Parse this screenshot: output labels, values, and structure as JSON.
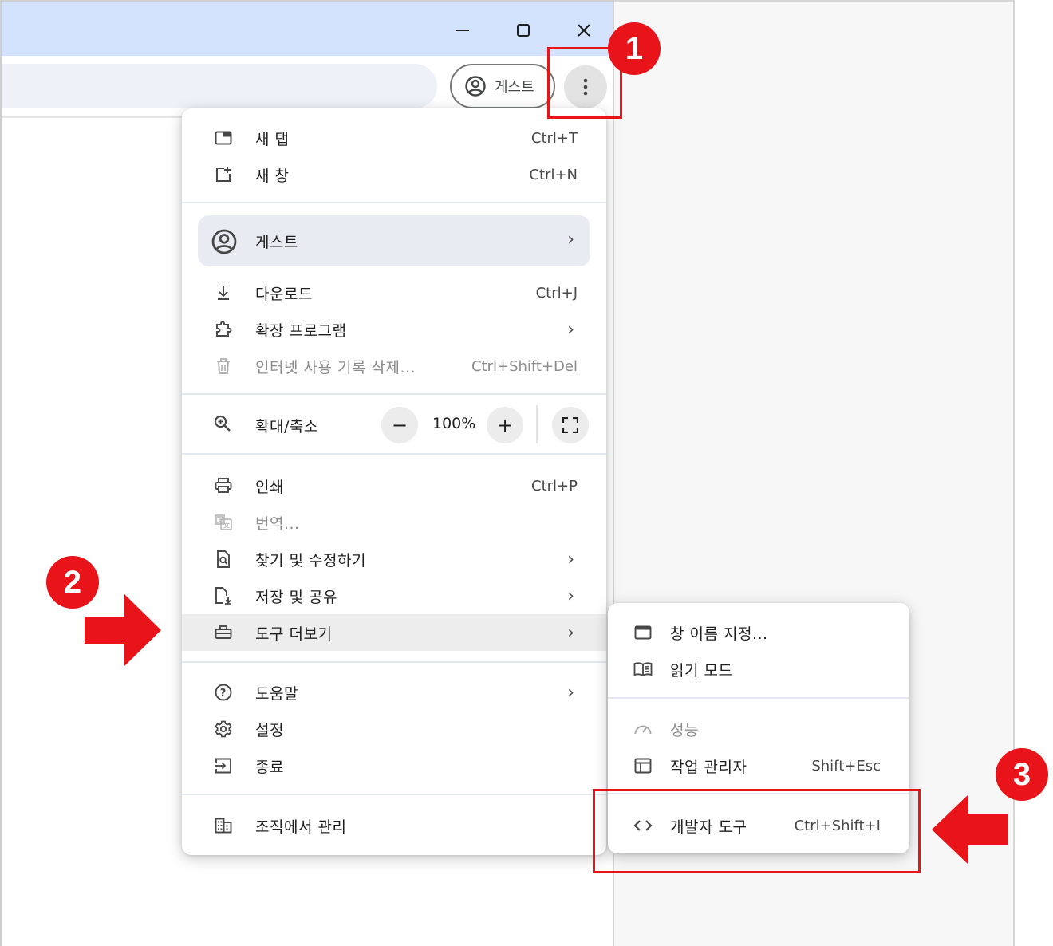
{
  "window": {
    "minimize_icon": "minimize-icon",
    "maximize_icon": "maximize-icon",
    "close_icon": "close-icon"
  },
  "toolbar": {
    "profile_label": "게스트",
    "menu_icon": "kebab-icon"
  },
  "menu": {
    "new_tab": {
      "label": "새 탭",
      "shortcut": "Ctrl+T"
    },
    "new_window": {
      "label": "새 창",
      "shortcut": "Ctrl+N"
    },
    "guest": {
      "label": "게스트"
    },
    "downloads": {
      "label": "다운로드",
      "shortcut": "Ctrl+J"
    },
    "extensions": {
      "label": "확장 프로그램"
    },
    "clear_history": {
      "label": "인터넷 사용 기록 삭제...",
      "shortcut": "Ctrl+Shift+Del"
    },
    "zoom": {
      "label": "확대/축소",
      "value": "100%",
      "minus": "−",
      "plus": "+"
    },
    "print": {
      "label": "인쇄",
      "shortcut": "Ctrl+P"
    },
    "translate": {
      "label": "번역..."
    },
    "find_edit": {
      "label": "찾기 및 수정하기"
    },
    "save_share": {
      "label": "저장 및 공유"
    },
    "more_tools": {
      "label": "도구 더보기"
    },
    "help": {
      "label": "도움말"
    },
    "settings": {
      "label": "설정"
    },
    "exit": {
      "label": "종료"
    },
    "managed": {
      "label": "조직에서 관리"
    }
  },
  "submenu": {
    "name_window": {
      "label": "창 이름 지정..."
    },
    "reading_mode": {
      "label": "읽기 모드"
    },
    "performance": {
      "label": "성능"
    },
    "task_manager": {
      "label": "작업 관리자",
      "shortcut": "Shift+Esc"
    },
    "devtools": {
      "label": "개발자 도구",
      "shortcut": "Ctrl+Shift+I"
    }
  },
  "annotations": {
    "badge_1": "1",
    "badge_2": "2",
    "badge_3": "3",
    "accent_color": "#e8141a"
  }
}
